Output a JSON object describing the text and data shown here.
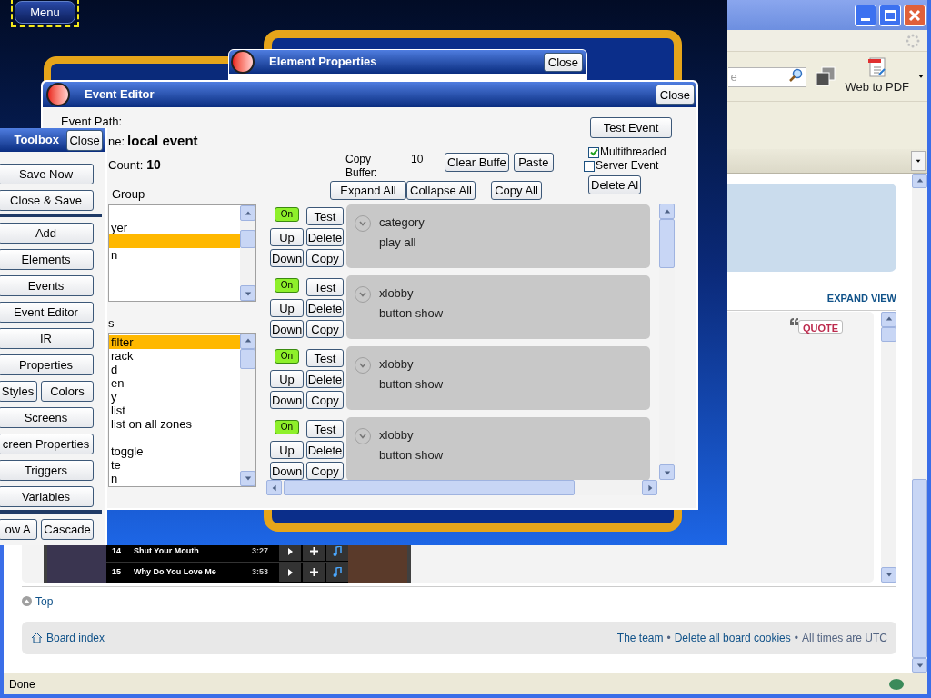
{
  "browser": {
    "search_placeholder": "e",
    "web_to_pdf": "Web to PDF",
    "expand_view": "EXPAND VIEW",
    "quote": "QUOTE",
    "tracks": [
      {
        "number": "14",
        "title": "Shut Your Mouth",
        "time": "3:27"
      },
      {
        "number": "15",
        "title": "Why Do You Love Me",
        "time": "3:53"
      }
    ],
    "top_link": "Top",
    "board_index": "Board index",
    "footer_links": [
      "The team",
      "Delete all board cookies"
    ],
    "footer_separator": "•",
    "footer_note": "All times are UTC",
    "status": "Done"
  },
  "app": {
    "menu_button": "Menu"
  },
  "element_properties": {
    "title": "Element Properties",
    "close": "Close"
  },
  "event_editor": {
    "title": "Event Editor",
    "close": "Close",
    "event_path_label": "Event Path:",
    "name_label": "ne:",
    "name_value": "local event",
    "count_label": "Count:",
    "count_value": "10",
    "group_label": "Group",
    "groups": [
      {
        "selected": false
      },
      {
        "text": "yer",
        "selected": false
      },
      {
        "selected": true
      },
      {
        "text": "n",
        "selected": false
      }
    ],
    "events_label": "s",
    "events": [
      {
        "text": "filter",
        "selected": true
      },
      {
        "text": "rack",
        "selected": false
      },
      {
        "text": "d",
        "selected": false
      },
      {
        "text": "en",
        "selected": false
      },
      {
        "text": "y",
        "selected": false
      },
      {
        "text": "list",
        "selected": false
      },
      {
        "text": "list on all zones",
        "selected": false
      },
      {
        "selected": false
      },
      {
        "text": "toggle",
        "selected": false
      },
      {
        "text": "te",
        "selected": false
      },
      {
        "text": "n",
        "selected": false
      }
    ],
    "copy_buffer_label": "Copy Buffer:",
    "copy_buffer_value": "10",
    "buffer_buttons": [
      "Clear Buffe",
      "Paste"
    ],
    "list_buttons": [
      "Expand All",
      "Collapse All",
      "Copy All"
    ],
    "test_event": "Test Event",
    "options": [
      {
        "label": "Multithreaded",
        "checked": true
      },
      {
        "label": "Server Event",
        "checked": false
      }
    ],
    "delete_all": "Delete Al",
    "actions": [
      {
        "toggle": "On",
        "on": true,
        "buttons": [
          "Test",
          "Up",
          "Delete",
          "Down",
          "Copy"
        ],
        "title": "category",
        "subtitle": "play all"
      },
      {
        "toggle": "On",
        "on": true,
        "buttons": [
          "Test",
          "Up",
          "Delete",
          "Down",
          "Copy"
        ],
        "title": "xlobby",
        "subtitle": "button show"
      },
      {
        "toggle": "On",
        "on": true,
        "buttons": [
          "Test",
          "Up",
          "Delete",
          "Down",
          "Copy"
        ],
        "title": "xlobby",
        "subtitle": "button show"
      },
      {
        "toggle": "On",
        "on": true,
        "buttons": [
          "Test",
          "Up",
          "Delete",
          "Down",
          "Copy"
        ],
        "title": "xlobby",
        "subtitle": "button show"
      }
    ]
  },
  "toolbox": {
    "title": "Toolbox",
    "close": "Close",
    "sections": [
      [
        [
          "Save Now"
        ],
        [
          "Close & Save"
        ]
      ],
      [
        [
          "Add"
        ],
        [
          "Elements"
        ],
        [
          "Events"
        ],
        [
          "Event Editor"
        ],
        [
          "IR"
        ],
        [
          "Properties"
        ],
        [
          "Styles",
          "Colors"
        ],
        [
          "Screens"
        ],
        [
          "creen Properties"
        ],
        [
          "Triggers"
        ],
        [
          "Variables"
        ]
      ],
      [
        [
          "ow A",
          "Cascade"
        ]
      ]
    ]
  }
}
